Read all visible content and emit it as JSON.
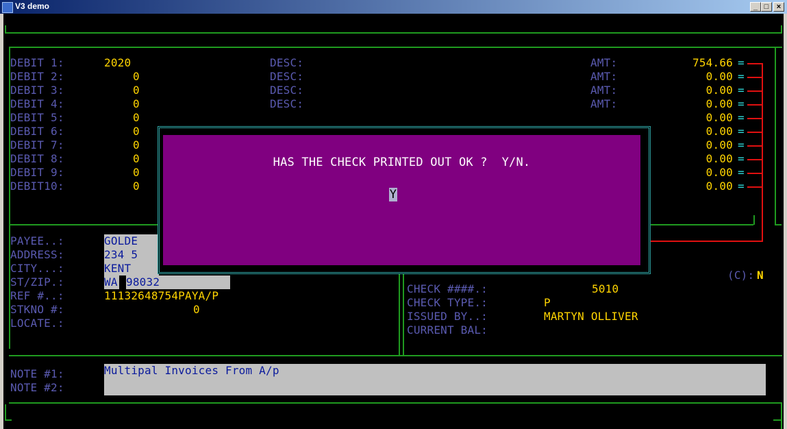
{
  "window": {
    "title": "V3 demo",
    "minimize": "_",
    "maximize": "□",
    "close": "×"
  },
  "debits": [
    {
      "label": "DEBIT 1:",
      "acct": "2020",
      "desc_label": "DESC:",
      "amt_label": "AMT:",
      "amount": "754.66"
    },
    {
      "label": "DEBIT 2:",
      "acct": "0",
      "desc_label": "DESC:",
      "amt_label": "AMT:",
      "amount": "0.00"
    },
    {
      "label": "DEBIT 3:",
      "acct": "0",
      "desc_label": "DESC:",
      "amt_label": "AMT:",
      "amount": "0.00"
    },
    {
      "label": "DEBIT 4:",
      "acct": "0",
      "desc_label": "DESC:",
      "amt_label": "AMT:",
      "amount": "0.00"
    },
    {
      "label": "DEBIT 5:",
      "acct": "0",
      "amount": "0.00"
    },
    {
      "label": "DEBIT 6:",
      "acct": "0",
      "amount": "0.00"
    },
    {
      "label": "DEBIT 7:",
      "acct": "0",
      "amount": "0.00"
    },
    {
      "label": "DEBIT 8:",
      "acct": "0",
      "amount": "0.00"
    },
    {
      "label": "DEBIT 9:",
      "acct": "0",
      "amount": "0.00"
    },
    {
      "label": "DEBIT10:",
      "acct": "0",
      "amount": "0.00"
    }
  ],
  "amount_marker": "=",
  "payee": {
    "payee_label": "PAYEE..:",
    "payee": "GOLDE",
    "address_label": "ADDRESS:",
    "address": "234 5",
    "city_label": "CITY...:",
    "city": "KENT",
    "stzip_label": "ST/ZIP.:",
    "state": "WA",
    "zip": "98032",
    "ref_label": "REF #..:",
    "ref": "11132648754PAYA/P",
    "stkno_label": "STKNO #:",
    "stkno": "0",
    "locate_label": "LOCATE.:"
  },
  "check": {
    "copy_label": "(C):",
    "copy_value": "N",
    "number_label": "CHECK ####.:",
    "number": "5010",
    "type_label": "CHECK TYPE.:",
    "type": "P",
    "issued_label": "ISSUED BY..:",
    "issued_by": "MARTYN OLLIVER",
    "balance_label": "CURRENT BAL:"
  },
  "notes": {
    "note1_label": "NOTE #1:",
    "note1": "Multipal Invoices From A/p",
    "note2_label": "NOTE #2:",
    "note2": ""
  },
  "dialog": {
    "message": "HAS THE CHECK PRINTED OUT OK ?  Y/N.",
    "input": "Y"
  },
  "colors": {
    "label": "#5a5ab0",
    "value": "#ffd400",
    "border": "#1f9a1f",
    "connector": "#e01010",
    "dialog": "#800080"
  }
}
